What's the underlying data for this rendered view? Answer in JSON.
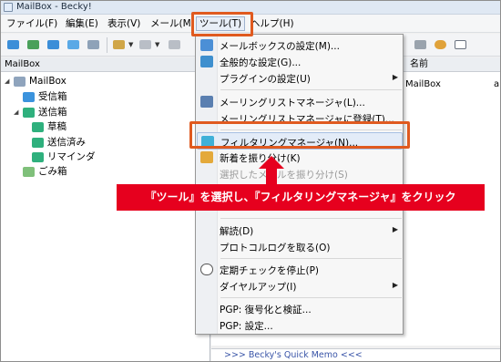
{
  "window": {
    "title": "MailBox - Becky!"
  },
  "menubar": {
    "items": [
      "ファイル(F)",
      "編集(E)",
      "表示(V)",
      "メール(M)",
      "ツール(T)",
      "ヘルプ(H)"
    ]
  },
  "left_pane": {
    "header": "MailBox",
    "tree": [
      {
        "label": "MailBox",
        "icon": "computer-icon"
      },
      {
        "label": "受信箱",
        "icon": "inbox-icon"
      },
      {
        "label": "送信箱",
        "icon": "outbox-icon"
      },
      {
        "label": "草稿",
        "icon": "draft-icon"
      },
      {
        "label": "送信済み",
        "icon": "sent-icon"
      },
      {
        "label": "リマインダ",
        "icon": "reminder-icon"
      },
      {
        "label": "ごみ箱",
        "icon": "trash-icon"
      }
    ]
  },
  "right_pane": {
    "column_name": "名前",
    "rows": [
      {
        "name": "MailBox",
        "extra": "a"
      }
    ],
    "memo": ">>> Becky's Quick Memo <<<"
  },
  "tools_menu": {
    "items": [
      {
        "label": "メールボックスの設定(M)...",
        "icon": "mailbox-settings-icon",
        "submenu": false,
        "disabled": false
      },
      {
        "label": "全般的な設定(G)...",
        "icon": "general-settings-icon",
        "submenu": false,
        "disabled": false
      },
      {
        "label": "プラグインの設定(U)",
        "icon": "",
        "submenu": true,
        "disabled": false
      },
      {
        "label": "メーリングリストマネージャ(L)...",
        "icon": "mailing-list-icon",
        "submenu": false,
        "disabled": false
      },
      {
        "label": "メーリングリストマネージャに登録(T)...",
        "icon": "",
        "submenu": false,
        "disabled": false
      },
      {
        "label": "フィルタリングマネージャ(N)...",
        "icon": "filter-icon",
        "submenu": false,
        "disabled": false
      },
      {
        "label": "新着を振り分け(K)",
        "icon": "sort-icon",
        "submenu": false,
        "disabled": false
      },
      {
        "label": "選択したメールを振り分け(S)",
        "icon": "",
        "submenu": false,
        "disabled": true
      },
      {
        "label": "解読(D)",
        "icon": "",
        "submenu": true,
        "disabled": false
      },
      {
        "label": "プロトコルログを取る(O)",
        "icon": "",
        "submenu": false,
        "disabled": false
      },
      {
        "label": "定期チェックを停止(P)",
        "icon": "clock-icon",
        "submenu": false,
        "disabled": false
      },
      {
        "label": "ダイヤルアップ(I)",
        "icon": "",
        "submenu": true,
        "disabled": false
      },
      {
        "label": "PGP: 復号化と検証...",
        "icon": "",
        "submenu": false,
        "disabled": false
      },
      {
        "label": "PGP: 設定...",
        "icon": "",
        "submenu": false,
        "disabled": false
      }
    ]
  },
  "callout": {
    "text": "『ツール』を選択し、『フィルタリングマネージャ』をクリック"
  },
  "colors": {
    "accent_red": "#e6001e",
    "highlight_box": "#e05a1f"
  }
}
